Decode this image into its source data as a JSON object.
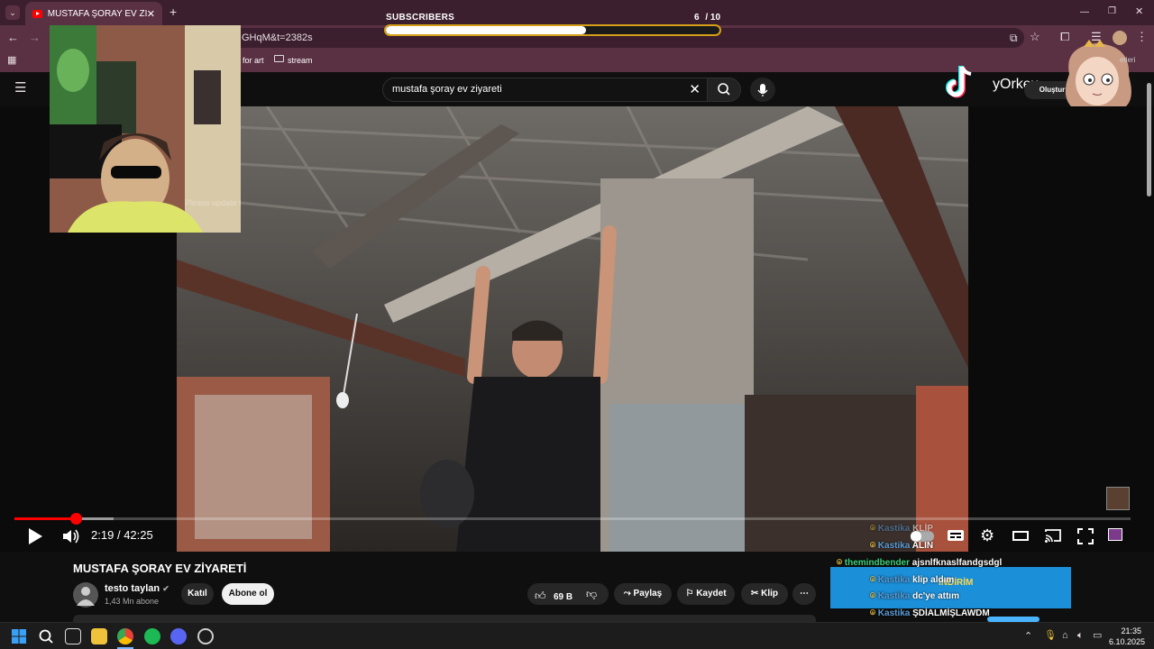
{
  "browser": {
    "tab_title": "MUSTAFA ŞORAY EV ZİYARETİ",
    "url_fragment": "GHqM&t=2382s",
    "bookmarks": [
      "for art",
      "stream"
    ]
  },
  "subscribers_goal": {
    "label": "SUBSCRIBERS",
    "count": "6",
    "goal": "/ 10",
    "progress_fraction": 0.6
  },
  "youtube": {
    "search_value": "mustafa şoray ev ziyareti",
    "create_label": "Oluştur",
    "tiktok_handle": "yOrkex"
  },
  "webcam": {
    "overlay_text": "Please update to latest Plus Plus"
  },
  "player": {
    "current_time": "2:19",
    "duration": "42:25",
    "time_separator": "/"
  },
  "video_info": {
    "title": "MUSTAFA ŞORAY EV ZİYARETİ",
    "channel": "testo taylan",
    "subscribers": "1,43 Mn abone",
    "join_label": "Katıl",
    "subscribe_label": "Abone ol",
    "likes": "69 B",
    "share_label": "Paylaş",
    "save_label": "Kaydet",
    "clip_label": "Klip"
  },
  "chat": [
    {
      "user": "Kastika",
      "message": "KLİP",
      "color": "#5b9bd5"
    },
    {
      "user": "Kastika",
      "message": "ALIN",
      "color": "#5b9bd5"
    },
    {
      "user": "themindbender",
      "message": "ajsnlfknaslfandgsdgl",
      "color": "#3ad07a"
    },
    {
      "user": "Kastika",
      "message": "klip aldım",
      "color": "#5b9bd5"
    },
    {
      "user": "Kastika",
      "message": "dc'ye attım",
      "color": "#5b9bd5"
    },
    {
      "user": "Kastika",
      "message": "ŞDİALMİŞLAWDM",
      "color": "#5b9bd5"
    }
  ],
  "ad_banner": {
    "text": "İNDİRİM"
  },
  "taskbar": {
    "time": "21:35",
    "date": "6.10.2025"
  }
}
